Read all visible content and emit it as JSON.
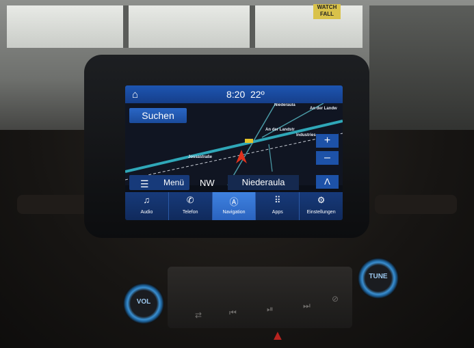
{
  "status": {
    "home_icon": "home-icon",
    "time": "8:20",
    "temperature": "22º"
  },
  "map": {
    "search_label": "Suchen",
    "zoom_in": "+",
    "zoom_out": "–",
    "streets": [
      "Niederaula",
      "An der Landstr",
      "An der Landw",
      "Jossastraße",
      "Industries",
      "E"
    ],
    "route_color": "#2fa7b8",
    "position_marker_color": "#e0321d"
  },
  "infobar": {
    "menu_label": "Menü",
    "heading": "NW",
    "city": "Niederaula",
    "recenter_icon": "navigation-arrow-icon"
  },
  "dock": [
    {
      "icon": "music-note-icon",
      "label": "Audio",
      "active": false
    },
    {
      "icon": "phone-icon",
      "label": "Telefon",
      "active": false
    },
    {
      "icon": "navigation-icon",
      "label": "Navigation",
      "active": true
    },
    {
      "icon": "apps-grid-icon",
      "label": "Apps",
      "active": false
    },
    {
      "icon": "settings-icon",
      "label": "Einstellungen",
      "active": false
    }
  ],
  "console": {
    "vol_label": "VOL",
    "tune_label": "TUNE"
  }
}
